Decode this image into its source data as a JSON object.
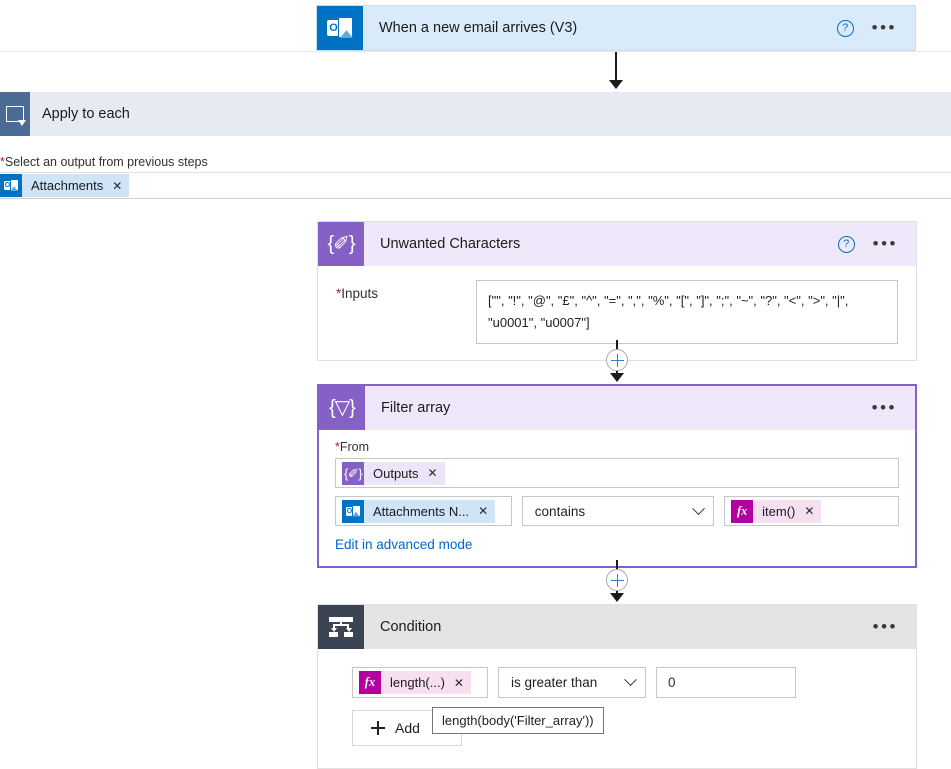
{
  "trigger": {
    "title": "When a new email arrives (V3)",
    "icon": "outlook-icon",
    "help_label": "?",
    "menu_label": "•••"
  },
  "loop": {
    "title": "Apply to each",
    "icon": "loop-icon",
    "field_label": "Select an output from previous steps",
    "required_marker": "*",
    "token": {
      "label": "Attachments",
      "remove_label": "✕",
      "icon": "outlook-icon"
    }
  },
  "compose_card": {
    "title": "Unwanted Characters",
    "icon": "compose-icon",
    "brace": "{✐}",
    "help_label": "?",
    "menu_label": "•••",
    "input_label": "Inputs",
    "required_marker": "*",
    "input_value": "[\"\", \"!\", \"@\", \"£\", \"^\", \"=\", \",\", \"%\", \"[\", \"]\", \";\", \"~\", \"?\", \"<\", \">\", \"|\", \"u0001\", \"u0007\"]"
  },
  "filter_card": {
    "title": "Filter array",
    "icon": "filter-array-icon",
    "brace": "{▽}",
    "menu_label": "•••",
    "from_label": "From",
    "required_marker": "*",
    "from_token": {
      "label": "Outputs",
      "remove_label": "✕",
      "icon": "compose-icon"
    },
    "left_token": {
      "label": "Attachments N...",
      "remove_label": "✕",
      "icon": "outlook-icon"
    },
    "operator": "contains",
    "right_token": {
      "label": "item()",
      "remove_label": "✕",
      "icon": "fx-icon",
      "fx_label": "fx"
    },
    "advanced_link": "Edit in advanced mode"
  },
  "condition_card": {
    "title": "Condition",
    "icon": "condition-icon",
    "menu_label": "•••",
    "left_token": {
      "label": "length(...)",
      "remove_label": "✕",
      "icon": "fx-icon",
      "fx_label": "fx"
    },
    "operator": "is greater than",
    "value": "0",
    "add_label": "Add",
    "tooltip": "length(body('Filter_array'))"
  },
  "colors": {
    "trigger_bg": "#d9ebfa",
    "outlook_blue": "#0072c6",
    "compose_purple": "#8661c5",
    "compose_head": "#eee8fa",
    "condition_dark": "#3b4452",
    "loop_blue": "#4a6b96",
    "loop_header_bg": "#e6eaf2",
    "fx_magenta": "#b4009e",
    "link_blue": "#0066cc",
    "required_red": "#a4262c"
  }
}
